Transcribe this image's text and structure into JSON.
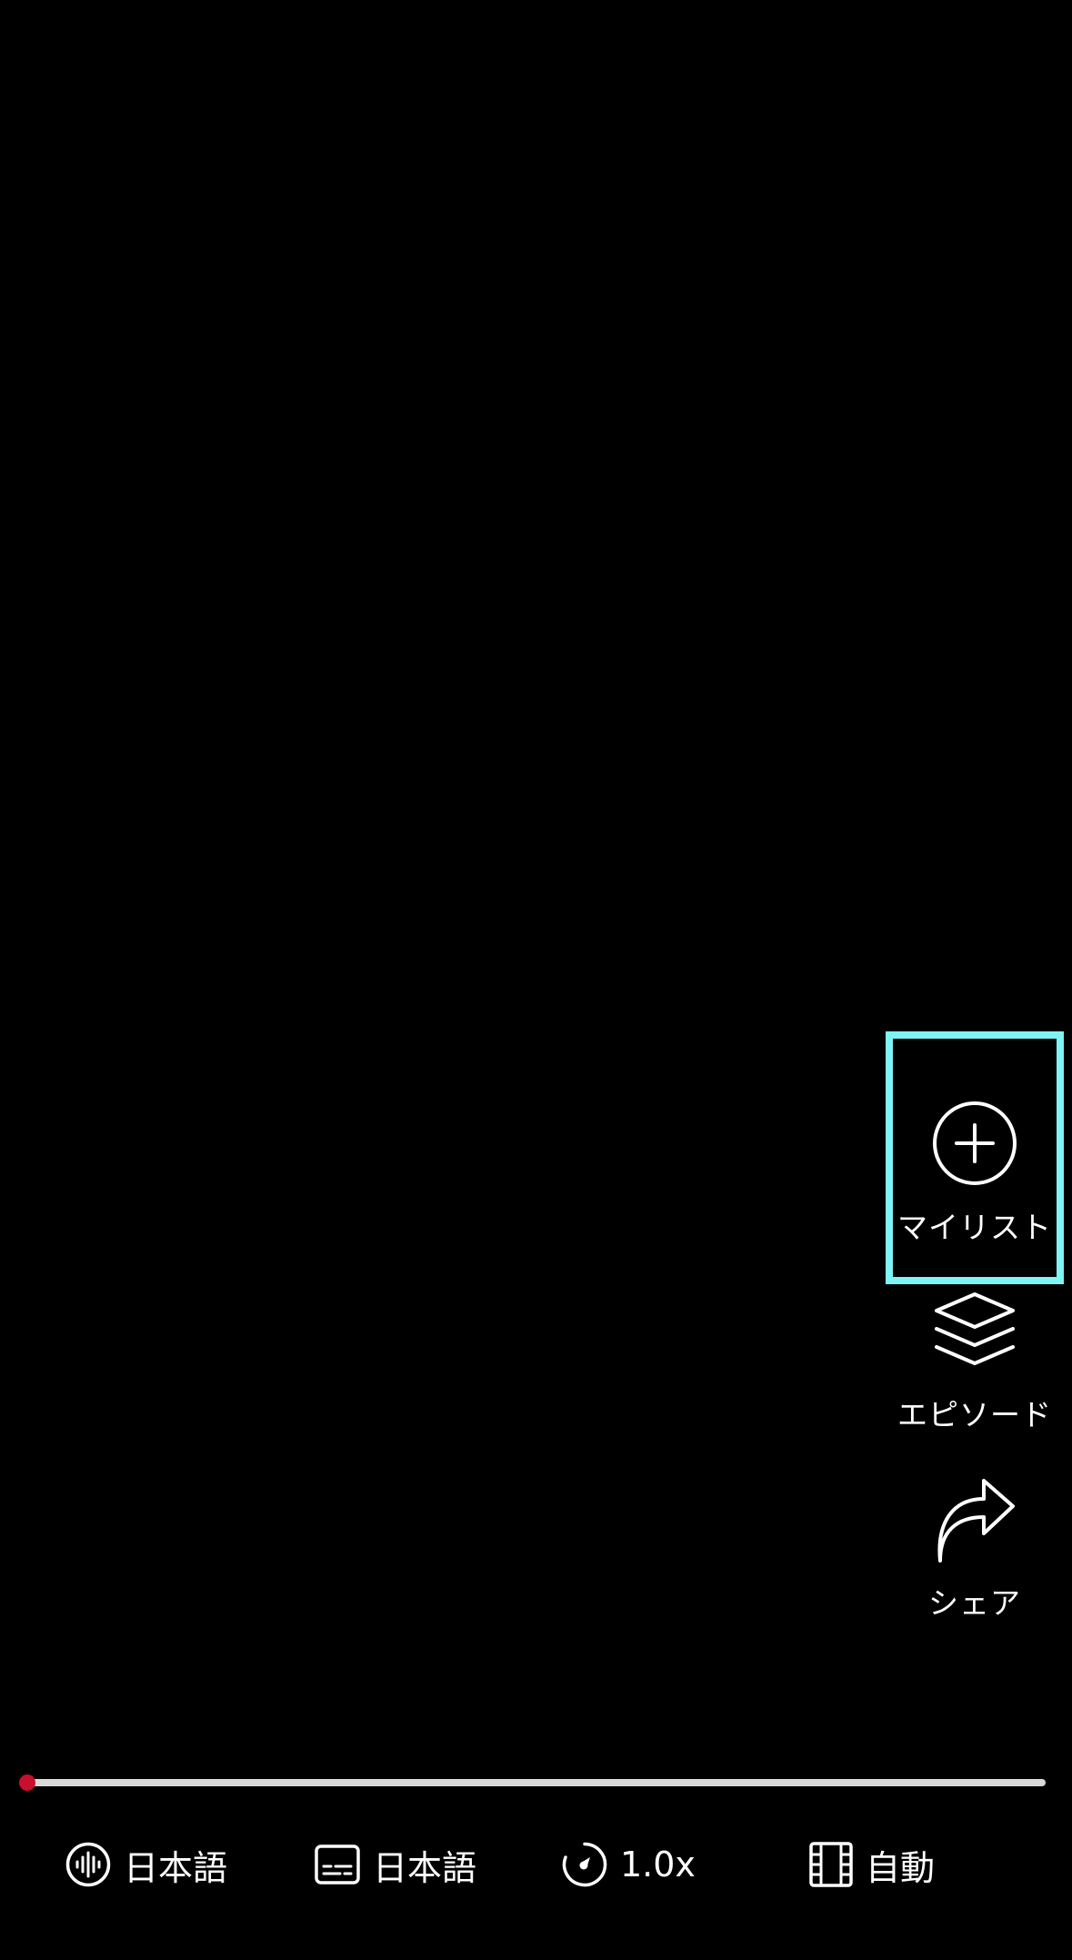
{
  "actions": {
    "mylist_label": "マイリスト",
    "episodes_label": "エピソード",
    "share_label": "シェア"
  },
  "player": {
    "progress_fraction": 0.0,
    "progress_color": "#c8102e",
    "track_color": "#d9d9d9",
    "highlight_color": "#7ef4f4"
  },
  "controls": {
    "audio_label": "日本語",
    "subtitle_label": "日本語",
    "speed_label": "1.0x",
    "quality_label": "自動"
  },
  "icons": {
    "mylist": "plus-circle-icon",
    "episodes": "layers-icon",
    "share": "share-arrow-icon",
    "audio": "audio-waveform-icon",
    "subtitle": "subtitles-icon",
    "speed": "speedometer-icon",
    "quality": "film-grid-icon"
  }
}
